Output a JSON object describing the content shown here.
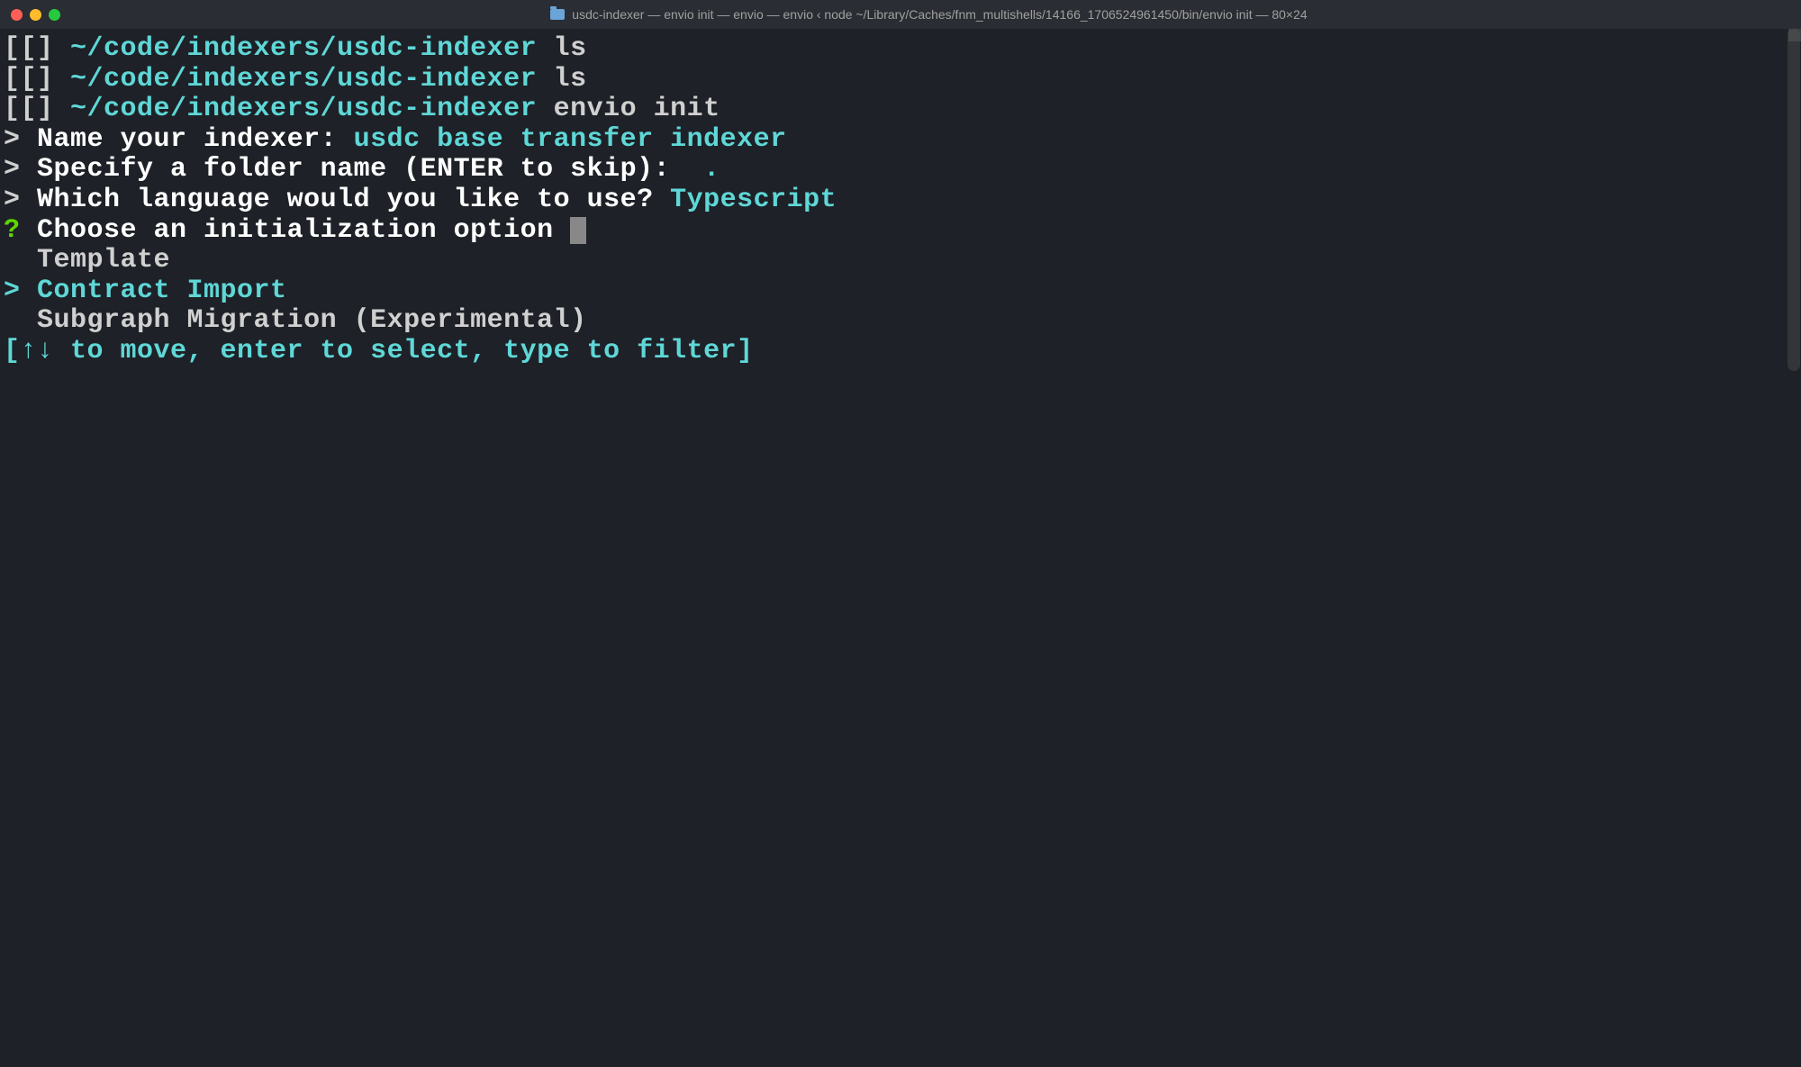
{
  "window": {
    "title": "usdc-indexer — envio init — envio — envio ‹ node ~/Library/Caches/fnm_multishells/14166_1706524961450/bin/envio init — 80×24"
  },
  "prompt": {
    "bracket": "[[] ",
    "path": "~/code/indexers/usdc-indexer"
  },
  "commands": {
    "ls1": "ls",
    "ls2": "ls",
    "envio": "envio init"
  },
  "qa": {
    "gt": ">",
    "q_mark": "?",
    "name_label": "Name your indexer: ",
    "name_answer": "usdc base transfer indexer",
    "folder_label": "Specify a folder name (ENTER to skip):  ",
    "folder_answer": ".",
    "lang_label": "Which language would you like to use? ",
    "lang_answer": "Typescript",
    "init_label": "Choose an initialization option "
  },
  "options": {
    "indent": "  ",
    "sel_marker": "> ",
    "template": "Template",
    "contract_import": "Contract Import",
    "subgraph": "Subgraph Migration (Experimental)"
  },
  "hint": "[↑↓ to move, enter to select, type to filter]"
}
